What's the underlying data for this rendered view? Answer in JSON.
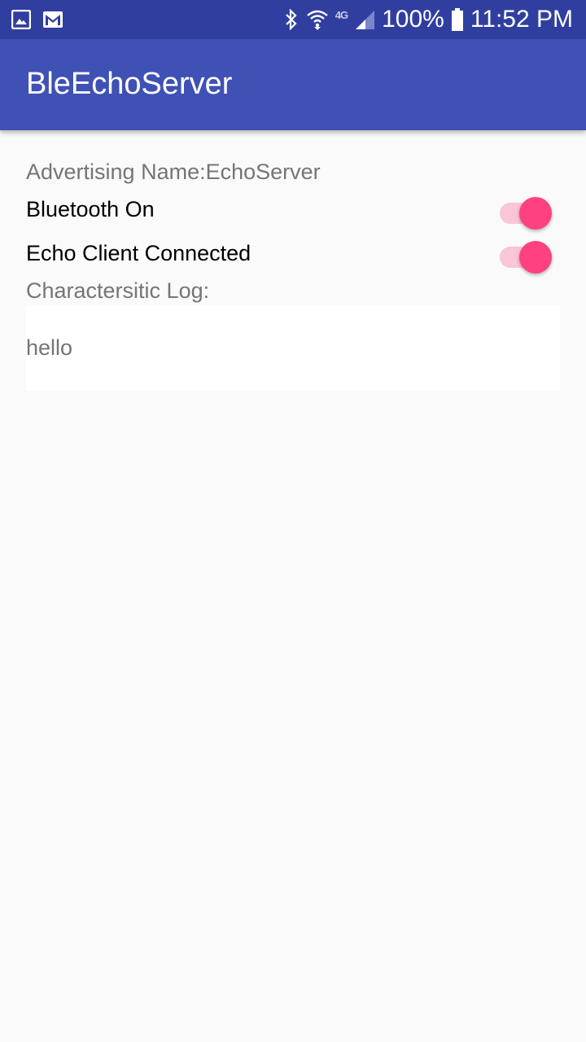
{
  "status_bar": {
    "left_icons": [
      "image-icon",
      "gmail-icon"
    ],
    "network_label": "4G",
    "battery_percent": "100%",
    "time": "11:52 PM"
  },
  "app_bar": {
    "title": "BleEchoServer"
  },
  "main": {
    "advertising_name": "Advertising Name:EchoServer",
    "bluetooth_switch": {
      "label": "Bluetooth On",
      "checked": true
    },
    "client_switch": {
      "label": "Echo Client Connected",
      "checked": true
    },
    "log_label": "Charactersitic Log:",
    "log_text": "hello"
  },
  "colors": {
    "status_bar": "#303f9f",
    "app_bar": "#3f51b5",
    "accent": "#ff4081",
    "background": "#fafafa"
  }
}
